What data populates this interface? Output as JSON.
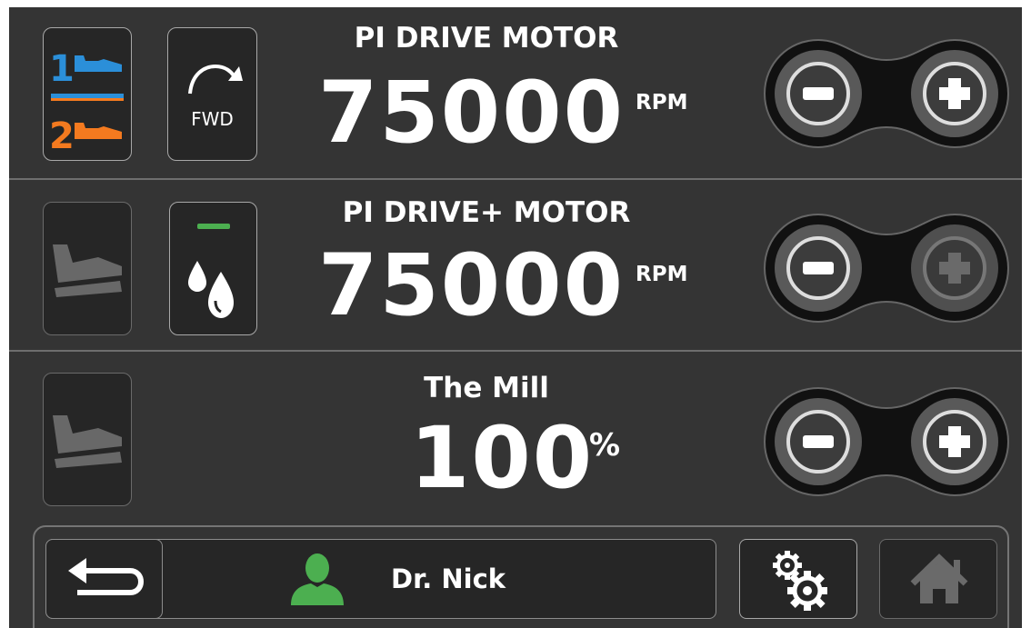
{
  "controls": [
    {
      "title": "PI DRIVE MOTOR",
      "value": "75000",
      "unit": "RPM",
      "pedal": {
        "top_number": "1",
        "bottom_number": "2",
        "top_color": "#2b8fd9",
        "bottom_color": "#f47a1f"
      },
      "direction": {
        "label": "FWD",
        "icon": "rotate-clockwise-icon"
      },
      "minus_icon": "minus-icon",
      "plus_icon": "plus-icon",
      "plus_enabled": true
    },
    {
      "title": "PI DRIVE+ MOTOR",
      "value": "75000",
      "unit": "RPM",
      "pedal": {
        "icon": "foot-pedal-icon",
        "active": false
      },
      "irrigation": {
        "icon": "water-drops-icon",
        "indicator_color": "#4caf50"
      },
      "minus_icon": "minus-icon",
      "plus_icon": "plus-icon",
      "plus_enabled": false
    },
    {
      "title": "The Mill",
      "value": "100",
      "unit": "%",
      "pedal": {
        "icon": "foot-pedal-icon",
        "active": false
      },
      "minus_icon": "minus-icon",
      "plus_icon": "plus-icon",
      "plus_enabled": true
    }
  ],
  "bottom_bar": {
    "back_icon": "back-arrow-icon",
    "user": {
      "name": "Dr. Nick",
      "icon": "user-icon",
      "icon_color": "#4caf50"
    },
    "settings_icon": "gears-icon",
    "home_icon": "home-icon"
  },
  "colors": {
    "background": "#343434",
    "tile": "#262626",
    "accent_green": "#4caf50",
    "accent_blue": "#2b8fd9",
    "accent_orange": "#f47a1f"
  }
}
